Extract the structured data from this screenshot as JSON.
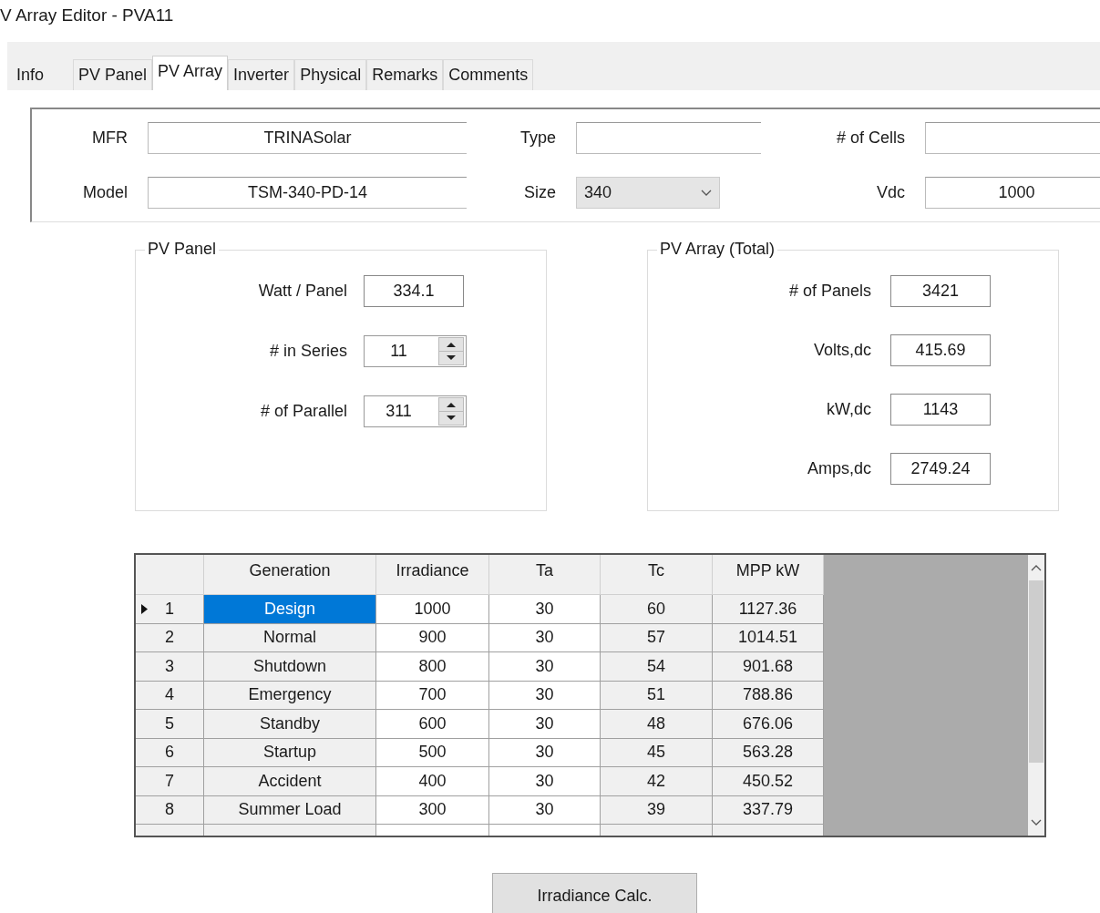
{
  "window": {
    "title": "V Array Editor - PVA11"
  },
  "tabs": [
    {
      "label": "Info",
      "selected": false
    },
    {
      "label": "PV Panel",
      "selected": false
    },
    {
      "label": "PV Array",
      "selected": true
    },
    {
      "label": "Inverter",
      "selected": false
    },
    {
      "label": "Physical",
      "selected": false
    },
    {
      "label": "Remarks",
      "selected": false
    },
    {
      "label": "Comments",
      "selected": false
    }
  ],
  "header": {
    "fields": [
      {
        "label": "MFR",
        "kind": "text",
        "value": "TRINASolar"
      },
      {
        "label": "Type",
        "kind": "text"
      },
      {
        "label": "# of Cells",
        "kind": "text"
      },
      {
        "label": "Model",
        "kind": "text",
        "value": "TSM-340-PD-14"
      },
      {
        "label": "Size",
        "kind": "combo",
        "value": "340"
      },
      {
        "label": "Vdc",
        "kind": "text",
        "value": "1000"
      }
    ]
  },
  "pv_panel": {
    "title": "PV Panel",
    "fields": [
      {
        "label": "Watt / Panel",
        "kind": "text",
        "value": "334.1"
      },
      {
        "label": "# in Series",
        "kind": "spin",
        "value": "11"
      },
      {
        "label": "# of Parallel",
        "kind": "spin",
        "value": "311"
      }
    ]
  },
  "pv_array": {
    "title": "PV Array (Total)",
    "fields": [
      {
        "label": "# of Panels",
        "kind": "text",
        "value": "3421"
      },
      {
        "label": "Volts,dc",
        "kind": "text",
        "value": "415.69"
      },
      {
        "label": "kW,dc",
        "kind": "text",
        "value": "1143"
      },
      {
        "label": "Amps,dc",
        "kind": "text",
        "value": "2749.24"
      }
    ]
  },
  "table": {
    "columns": [
      "Generation",
      "Irradiance",
      "Ta",
      "Tc",
      "MPP kW"
    ],
    "rows": [
      {
        "number": "1",
        "selected": true,
        "cells": [
          "Design",
          "1000",
          "30",
          "60",
          "1127.36"
        ]
      },
      {
        "number": "2",
        "selected": false,
        "cells": [
          "Normal",
          "900",
          "30",
          "57",
          "1014.51"
        ]
      },
      {
        "number": "3",
        "selected": false,
        "cells": [
          "Shutdown",
          "800",
          "30",
          "54",
          "901.68"
        ]
      },
      {
        "number": "4",
        "selected": false,
        "cells": [
          "Emergency",
          "700",
          "30",
          "51",
          "788.86"
        ]
      },
      {
        "number": "5",
        "selected": false,
        "cells": [
          "Standby",
          "600",
          "30",
          "48",
          "676.06"
        ]
      },
      {
        "number": "6",
        "selected": false,
        "cells": [
          "Startup",
          "500",
          "30",
          "45",
          "563.28"
        ]
      },
      {
        "number": "7",
        "selected": false,
        "cells": [
          "Accident",
          "400",
          "30",
          "42",
          "450.52"
        ]
      },
      {
        "number": "8",
        "selected": false,
        "cells": [
          "Summer Load",
          "300",
          "30",
          "39",
          "337.79"
        ]
      }
    ]
  },
  "button": {
    "label": "Irradiance Calc."
  }
}
